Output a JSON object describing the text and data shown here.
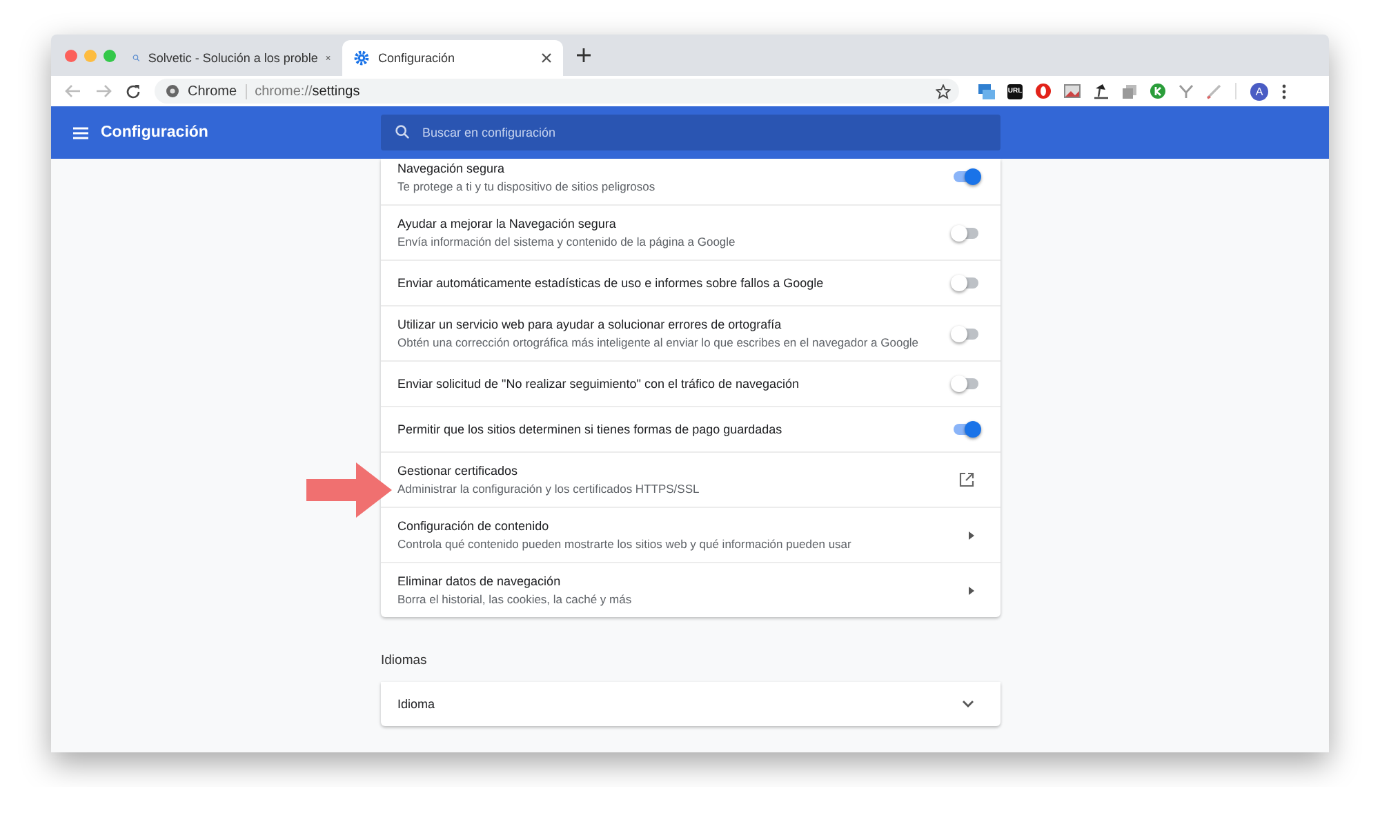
{
  "tabs": [
    {
      "title": "Solvetic - Solución a los proble",
      "kind": "search",
      "selected": false
    },
    {
      "title": "Configuración",
      "kind": "gear",
      "selected": true
    }
  ],
  "address_bar": {
    "site": "Chrome",
    "url_prefix": "chrome://",
    "url_path": "settings"
  },
  "extensions": [
    {
      "kind": "chat"
    },
    {
      "kind": "label",
      "text": "URL"
    },
    {
      "kind": "red"
    },
    {
      "kind": "image"
    },
    {
      "kind": "lamp"
    },
    {
      "kind": "copy"
    },
    {
      "kind": "k"
    },
    {
      "kind": "funnel"
    },
    {
      "kind": "pen"
    }
  ],
  "profile": {
    "initial": "A"
  },
  "header": {
    "title": "Configuración",
    "search_placeholder": "Buscar en configuración"
  },
  "settings": [
    {
      "title": "Navegación segura",
      "subtitle": "Te protege a ti y tu dispositivo de sitios peligrosos",
      "kind": "toggle",
      "on": true
    },
    {
      "title": "Ayudar a mejorar la Navegación segura",
      "subtitle": "Envía información del sistema y contenido de la página a Google",
      "kind": "toggle",
      "on": false
    },
    {
      "title": "Enviar automáticamente estadísticas de uso e informes sobre fallos a Google",
      "kind": "toggle",
      "on": false
    },
    {
      "title": "Utilizar un servicio web para ayudar a solucionar errores de ortografía",
      "subtitle": "Obtén una corrección ortográfica más inteligente al enviar lo que escribes en el navegador a Google",
      "kind": "toggle",
      "on": false
    },
    {
      "title": "Enviar solicitud de \"No realizar seguimiento\" con el tráfico de navegación",
      "kind": "toggle",
      "on": false
    },
    {
      "title": "Permitir que los sitios determinen si tienes formas de pago guardadas",
      "kind": "toggle",
      "on": true
    },
    {
      "title": "Gestionar certificados",
      "subtitle": "Administrar la configuración y los certificados HTTPS/SSL",
      "kind": "external"
    },
    {
      "title": "Configuración de contenido",
      "subtitle": "Controla qué contenido pueden mostrarte los sitios web y qué información pueden usar",
      "kind": "submenu"
    },
    {
      "title": "Eliminar datos de navegación",
      "subtitle": "Borra el historial, las cookies, la caché y más",
      "kind": "submenu"
    }
  ],
  "languages": {
    "heading": "Idiomas",
    "rows": [
      {
        "title": "Idioma",
        "kind": "expand",
        "expanded": false
      }
    ]
  }
}
